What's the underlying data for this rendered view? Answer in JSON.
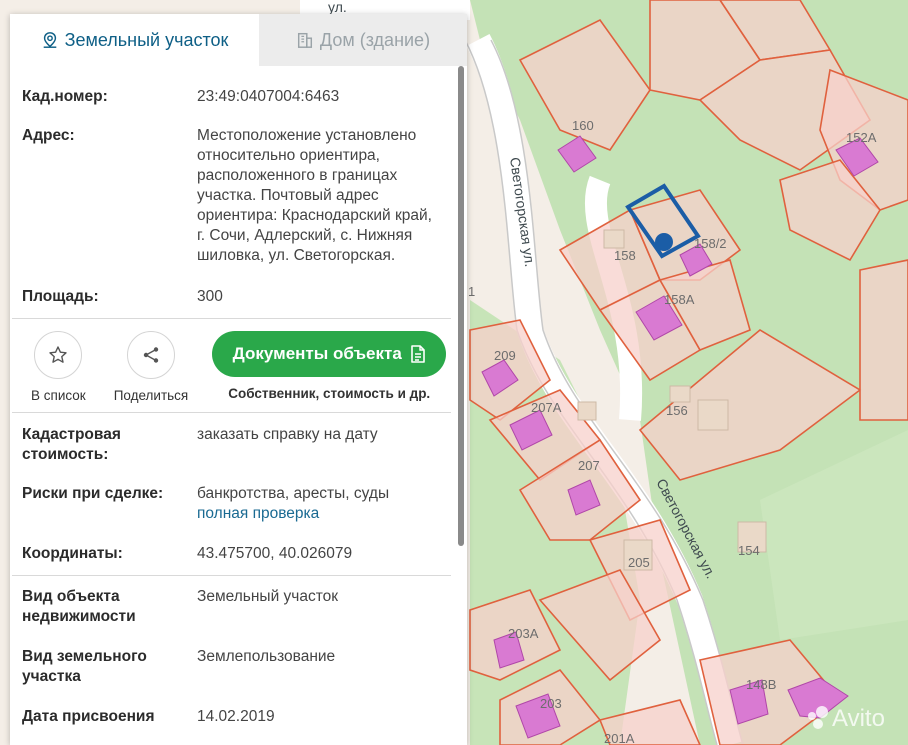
{
  "tabs": {
    "land": "Земельный участок",
    "house": "Дом (здание)"
  },
  "info": {
    "cad_label": "Кад.номер:",
    "cad_value": "23:49:0407004:6463",
    "address_label": "Адрес:",
    "address_value": "Местоположение установлено относительно ориентира, расположенного в границах участка. Почтовый адрес ориентира: Краснодарский край, г. Сочи, Адлерский, с. Нижняя шиловка, ул. Светогорская.",
    "area_label": "Площадь:",
    "area_value": "300"
  },
  "actions": {
    "to_list": "В список",
    "share": "Поделиться",
    "documents_button": "Документы объекта",
    "documents_sub": "Собственник, стоимость и др."
  },
  "details": {
    "cost_label": "Кадастровая стоимость:",
    "cost_link": "заказать справку на дату",
    "risks_label": "Риски при сделке:",
    "risks_value": "банкротства, аресты, суды",
    "risks_link": "полная проверка",
    "coords_label": "Координаты:",
    "coords_value": "43.475700, 40.026079",
    "object_type_label": "Вид объекта недвижимости",
    "object_type_value": "Земельный участок",
    "land_type_label": "Вид земельного участка",
    "land_type_value": "Землепользование",
    "date_label": "Дата присвоения",
    "date_value": "14.02.2019"
  },
  "map": {
    "street_top": "ул.",
    "street_1": "Светогорская ул.",
    "street_2": "Светогорская ул.",
    "plots": [
      "160",
      "152А",
      "158",
      "158/2",
      "158А",
      "156",
      "209",
      "207А",
      "207",
      "205",
      "154",
      "203А",
      "203",
      "148В",
      "201А",
      "1"
    ],
    "watermark": "Avito"
  },
  "colors": {
    "accent": "#0e5f86",
    "button_green": "#2aa84a",
    "parcel_fill": "#f7d0cb",
    "parcel_stroke": "#e0613e",
    "building_fill": "#d97ad2",
    "selected_stroke": "#1b5da6"
  }
}
